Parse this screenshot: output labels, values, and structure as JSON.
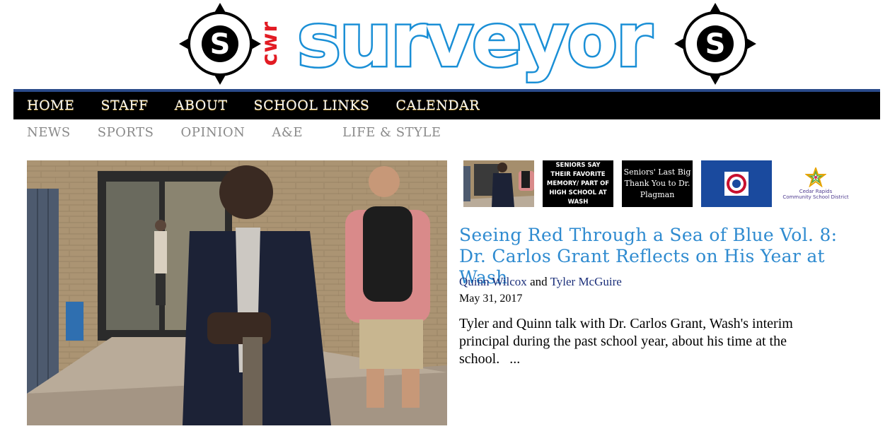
{
  "masthead": {
    "small_text": "cwr",
    "title": "surveyor",
    "compass_letter": "S"
  },
  "nav_primary": {
    "items": [
      "HOME",
      "STAFF",
      "ABOUT",
      "SCHOOL LINKS",
      "CALENDAR"
    ]
  },
  "nav_secondary": {
    "items": [
      "NEWS",
      "SPORTS",
      "OPINION",
      "A&E",
      "LIFE & STYLE"
    ]
  },
  "thumbnails": {
    "t2_text": "SENIORS SAY THEIR FAVORITE MEMORY/ PART OF HIGH SCHOOL AT WASH",
    "t3_text": "Seniors' Last Big Thank You to Dr. Plagman",
    "t5_text_line1": "Cedar Rapids",
    "t5_text_line2": "Community School District"
  },
  "article": {
    "headline": "Seeing Red Through a Sea of Blue Vol. 8: Dr. Carlos Grant Reflects on His Year at Wash",
    "author1": "Quinn Wilcox",
    "conjunction": "and",
    "author2": "Tyler McGuire",
    "date": "May 31, 2017",
    "excerpt": "Tyler and Quinn talk with Dr. Carlos Grant, Wash's interim principal during the past school year, about his time at the school.",
    "more": "..."
  }
}
